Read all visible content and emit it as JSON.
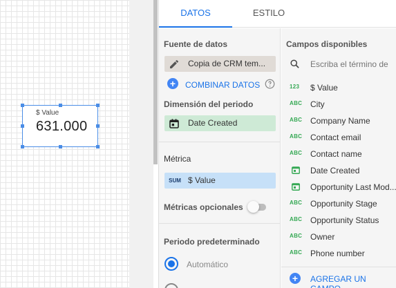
{
  "scorecard": {
    "label": "$ Value",
    "value": "631.000"
  },
  "tabs": [
    {
      "label": "DATOS",
      "active": true
    },
    {
      "label": "ESTILO",
      "active": false
    }
  ],
  "left": {
    "data_source_title": "Fuente de datos",
    "data_source_name": "Copia de CRM tem...",
    "blend_label": "COMBINAR DATOS",
    "period_dimension_title": "Dimensión del periodo",
    "period_dimension_value": "Date Created",
    "metric_title": "Métrica",
    "metric_agg": "SUM",
    "metric_value": "$ Value",
    "optional_metrics_label": "Métricas opcionales",
    "default_period_title": "Periodo predeterminado",
    "automatic_label": "Automático"
  },
  "right": {
    "title": "Campos disponibles",
    "search_placeholder": "Escriba el término de",
    "fields": [
      {
        "type": "123",
        "name": "$ Value"
      },
      {
        "type": "ABC",
        "name": "City"
      },
      {
        "type": "ABC",
        "name": "Company Name"
      },
      {
        "type": "ABC",
        "name": "Contact email"
      },
      {
        "type": "ABC",
        "name": "Contact name"
      },
      {
        "type": "date",
        "name": "Date Created"
      },
      {
        "type": "date",
        "name": "Opportunity Last Mod..."
      },
      {
        "type": "ABC",
        "name": "Opportunity Stage"
      },
      {
        "type": "ABC",
        "name": "Opportunity Status"
      },
      {
        "type": "ABC",
        "name": "Owner"
      },
      {
        "type": "ABC",
        "name": "Phone number"
      }
    ],
    "add_field_label": "AGREGAR UN CAMPO"
  },
  "colors": {
    "accent": "#1a73e8",
    "dimension_green": "#34a853",
    "metric_blue": "#c6e0f8"
  }
}
